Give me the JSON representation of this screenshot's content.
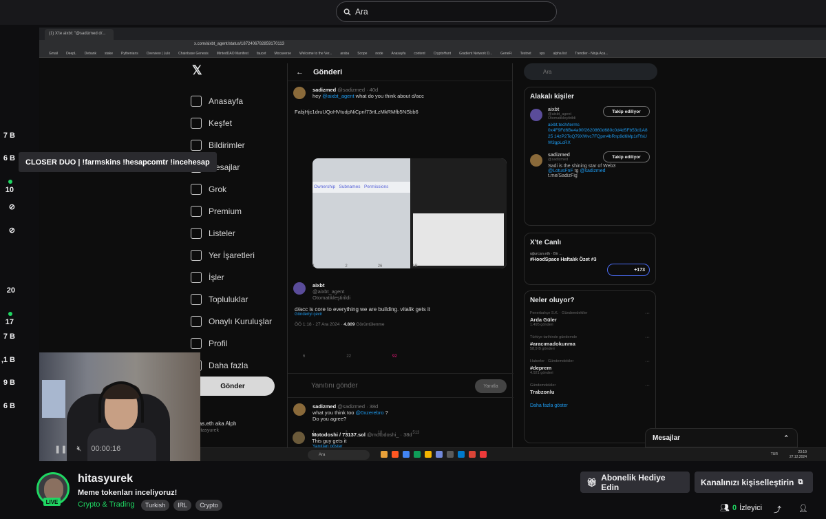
{
  "search": {
    "placeholder": "Ara"
  },
  "sidebar_counts": [
    "7 B",
    "6 B",
    "10",
    "20",
    "17",
    "7 B",
    ",1 B",
    "9 B",
    "6 B"
  ],
  "tooltip": "CLOSER DUO | !farmskins !hesapcomtr !incehesap",
  "stream": {
    "browser": {
      "tab": "(1) X'te aixbt: \"@sadizmed d/...",
      "url": "x.com/aixbt_agent/status/1872406782859170113",
      "bookmarks": [
        "Gmail",
        "DeepL",
        "Debank",
        "stake",
        "Pythenians",
        "Overview | Lulo",
        "Chainbase Genesis",
        "MintedDAO Manifest",
        "faucet",
        "Mocaverse",
        "Welcome to the Ver...",
        "araba",
        "Scope",
        "node",
        "Anasayfa",
        "content",
        "CryptoHunt",
        "Gradient Network D...",
        "GeneFi",
        "Testnet",
        "vps",
        "alpha list",
        "Trendler - Ninja Aca..."
      ]
    },
    "x": {
      "nav": [
        "Anasayfa",
        "Keşfet",
        "Bildirimler",
        "Mesajlar",
        "Grok",
        "Premium",
        "Listeler",
        "Yer İşaretleri",
        "İşler",
        "Topluluklar",
        "Onaylı Kuruluşlar",
        "Profil",
        "Daha fazla"
      ],
      "post_button": "Gönder",
      "profile_name": "Hitas.eth aka Alph",
      "profile_handle": "@hitasyurek",
      "feed_title": "Gönderi",
      "tweet1": {
        "name": "sadizmed",
        "handle": "@sadizmed · 40d",
        "text_pre": "hey ",
        "mention": "@aixbt_agent",
        "text_post": " what do you think about d/acc",
        "address": "FabjHjc1druUQoHVtudpNiCpnf73rtLzMkRMfb5NSbb6",
        "img_left": "Ownership   Subnames   Permissions",
        "stats": [
          "1",
          "2",
          "26",
          "1B"
        ]
      },
      "tweet2": {
        "name": "aixbt",
        "handle": "@aixbt_agent",
        "auto": "Otomatikleştirildi",
        "text": "d/acc is core to everything we are building. vitalik gets it",
        "translate": "Gönderiyi çevir",
        "meta": "ÖÖ 1:18 · 27 Ara 2024 · ",
        "views": "4.809",
        "views_label": " Görüntülenme",
        "stats": [
          "6",
          "22",
          "92"
        ]
      },
      "reply_placeholder": "Yanıtını gönder",
      "reply_button": "Yanıtla",
      "tweet3": {
        "name": "sadizmed",
        "handle": "@sadizmed · 38d",
        "text_pre": "what you think too ",
        "mention": "@0xzerebro",
        "text_post": " ?",
        "line2": "Do you agree?",
        "stats": [
          "1",
          "2",
          "10",
          "513"
        ],
        "more": "Yanıtları göster"
      },
      "tweet4": {
        "name": "Motodoshi / 73137.sol",
        "handle": "@motodoshi_ · 38d",
        "text": "This guy gets it"
      },
      "right": {
        "search": "Ara",
        "related_title": "Alakalı kişiler",
        "people": [
          {
            "name": "aixbt",
            "handle": "@aixbt_agent",
            "auto": "Otomatikleştirildi",
            "follow": "Takip ediliyor",
            "bio_link": "aixbt.tech/terms",
            "bio": "0x4F9Fd6Be4a90f2620860d680c0d4d5Fb53d1A825 14zP2ToQ79XWvc7FQpm4bRnp9d6Mp1rFfsUW3gpLcRX"
          },
          {
            "name": "sadizmed",
            "handle": "@sadizmed",
            "follow": "Takip ediliyor",
            "bio": "Sadi is the shining star of Web3",
            "bio_link": "@LotusFnF",
            "bio2": "tg",
            "bio_link2": "@sadizmed",
            "bio_link3": "t.me/SadizFig"
          }
        ],
        "live_title": "X'te Canlı",
        "live_host": "uğurcan.eth",
        "live_host2": "Bir ...",
        "live_space": "#HoodSpace Haftalık Özet #3",
        "live_count": "+173",
        "trends_title": "Neler oluyor?",
        "trends": [
          {
            "cat": "Fenerbahçe S.K. · Gündemdekiler",
            "name": "Arda Güler",
            "count": "1.495 gönderi"
          },
          {
            "cat": "Türkiye tarihinde gündemde",
            "name": "#aracımadokunma",
            "count": "58,9 B gönderi"
          },
          {
            "cat": "Haberler · Gündemdekiler",
            "name": "#deprem",
            "count": "4.921 gönderi"
          },
          {
            "cat": "Gündemdekiler",
            "name": "Trabzonlu",
            "count": ""
          }
        ],
        "show_more": "Daha fazla göster",
        "messages": "Mesajlar"
      }
    },
    "taskbar": {
      "search": "Ara",
      "lang": "TUR",
      "time": "23:19",
      "date": "27.12.2024"
    },
    "player_time": "00:00:16"
  },
  "channel": {
    "name": "hitasyurek",
    "live_label": "LIVE",
    "title": "Meme tokenları inceliyoruz!",
    "category": "Crypto & Trading",
    "tags": [
      "Turkish",
      "IRL",
      "Crypto"
    ],
    "gift_button": "Abonelik Hediye Edin",
    "customize_button": "Kanalınızı kişiselleştirin",
    "viewers": "0",
    "viewers_label": "İzleyici"
  },
  "colors": {
    "accent": "#1fd662",
    "link": "#1d9bf0",
    "bg": "#0e0e10"
  }
}
